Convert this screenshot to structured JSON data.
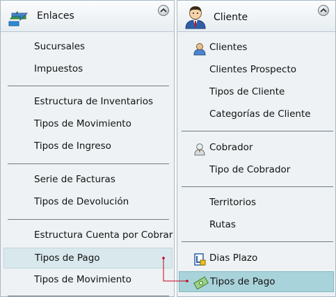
{
  "left_panel": {
    "title": "Enlaces",
    "groups": [
      {
        "items": [
          "Sucursales",
          "Impuestos"
        ]
      },
      {
        "items": [
          "Estructura de Inventarios",
          "Tipos de Movimiento",
          "Tipos de Ingreso"
        ]
      },
      {
        "items": [
          "Serie de Facturas",
          "Tipos de Devolución"
        ]
      },
      {
        "items": [
          "Estructura Cuenta por Cobrar",
          "Tipos de Pago",
          "Tipos de Movimiento"
        ]
      }
    ]
  },
  "right_panel": {
    "title": "Cliente",
    "groups": [
      {
        "items": [
          "Clientes",
          "Clientes Prospecto",
          "Tipos de Cliente",
          "Categorías de Cliente"
        ]
      },
      {
        "items": [
          "Cobrador",
          "Tipo de Cobrador"
        ]
      },
      {
        "items": [
          "Territorios",
          "Rutas"
        ]
      },
      {
        "items": [
          "Dias Plazo",
          "Tipos de Pago"
        ]
      }
    ]
  },
  "colors": {
    "hover_bg": "#d9e8ec",
    "selected_bg": "#a9d3da",
    "connector": "#c4001c"
  }
}
